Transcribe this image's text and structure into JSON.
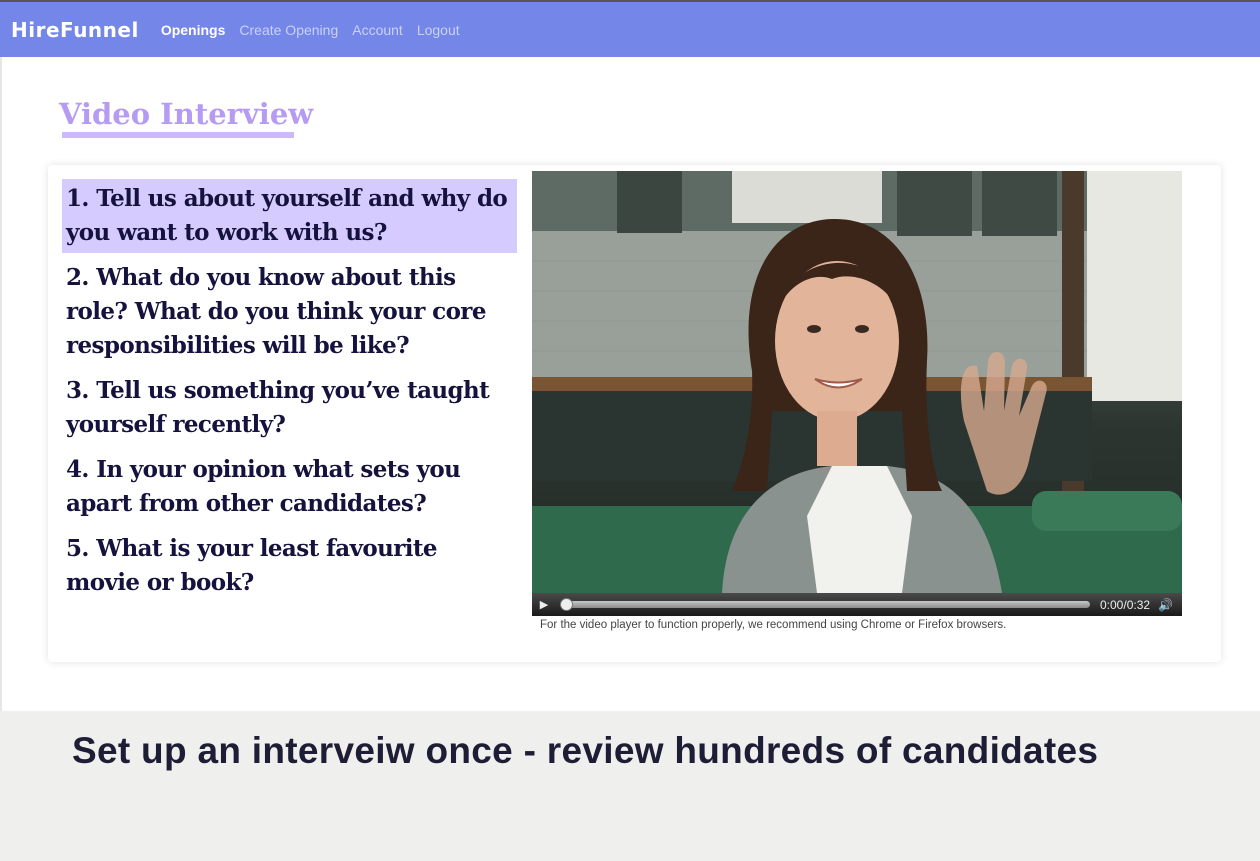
{
  "nav": {
    "brand": "HireFunnel",
    "items": [
      {
        "label": "Openings",
        "active": true
      },
      {
        "label": "Create Opening",
        "active": false
      },
      {
        "label": "Account",
        "active": false
      },
      {
        "label": "Logout",
        "active": false
      }
    ]
  },
  "page": {
    "title": "Video Interview"
  },
  "questions": [
    "1. Tell us about yourself and why do you want to work with us?",
    "2. What do you know about this role? What do you think your core responsibilities will be like?",
    "3. Tell us something you’ve taught yourself recently?",
    "4. In your opinion what sets you apart from other candidates?",
    "5. What is your least favourite movie or book?"
  ],
  "video": {
    "time": "0:00/0:32",
    "progress": 0,
    "note": "For the video player to function properly, we recommend using Chrome or Firefox browsers."
  },
  "banner": {
    "text": "Set up an interveiw once - review hundreds of  candidates"
  },
  "colors": {
    "nav_bg": "#7486e8",
    "title": "#b69bf2",
    "active_question_bg": "#d6cbff"
  }
}
